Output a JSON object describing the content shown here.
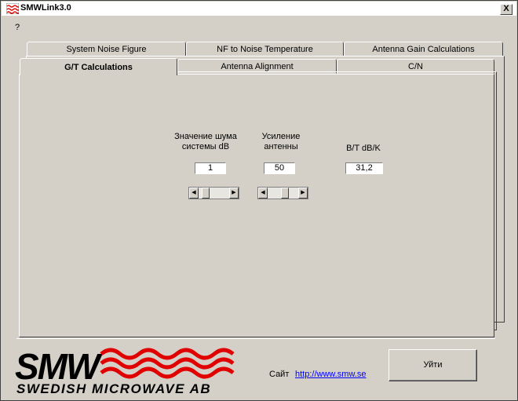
{
  "window": {
    "title": "SMWLink3.0",
    "close_label": "X"
  },
  "menu": {
    "help": "?"
  },
  "tabs_back": [
    "System Noise Figure",
    "NF to Noise Temperature",
    "Antenna Gain Calculations"
  ],
  "tabs_front": [
    "G/T Calculations",
    "Antenna Alignment",
    "C/N"
  ],
  "active_tab": "G/T Calculations",
  "gt": {
    "noise_label_1": "Значение шума",
    "noise_label_2": "системы dB",
    "noise_value": "1",
    "gain_label_1": "Усиление",
    "gain_label_2": "антенны",
    "gain_value": "50",
    "result_label": "B/T dB/K",
    "result_value": "31,2"
  },
  "footer": {
    "logo_top": "SMW",
    "logo_bottom": "SWEDISH MICROWAVE AB",
    "site_label": "Сайт",
    "site_url": "http://www.smw.se",
    "exit_label": "Уйти"
  },
  "colors": {
    "logo_red": "#e00000",
    "face": "#d4d0c8",
    "link": "#0000ff"
  }
}
